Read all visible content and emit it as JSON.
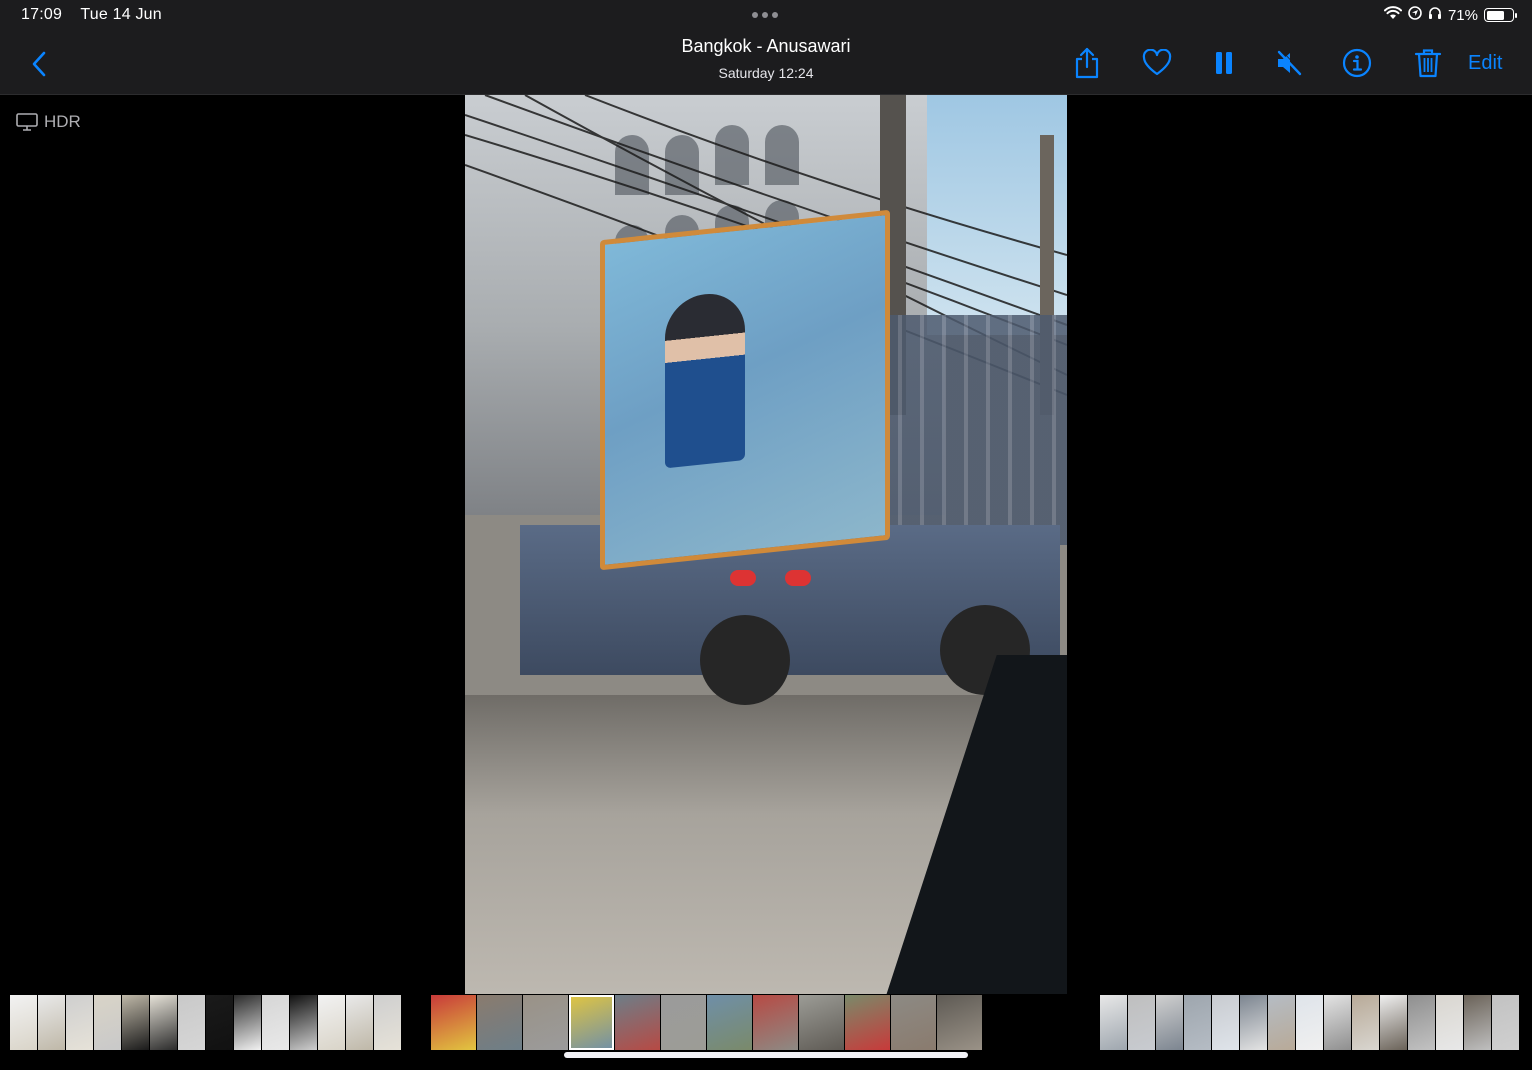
{
  "status_bar": {
    "time": "17:09",
    "date": "Tue 14 Jun",
    "battery_percent_label": "71%",
    "battery_level": 0.71,
    "icons": [
      "wifi-icon",
      "location-icon",
      "headphones-icon",
      "battery-icon"
    ]
  },
  "nav": {
    "title": "Bangkok - Anusawari",
    "subtitle": "Saturday  12:24",
    "edit_label": "Edit",
    "icons": [
      "back-chevron-icon",
      "share-icon",
      "heart-icon",
      "pause-icon",
      "mute-icon",
      "info-icon",
      "trash-icon"
    ],
    "accent_color": "#0a84ff"
  },
  "hdr": {
    "label": "HDR",
    "icon": "display-icon"
  },
  "media": {
    "type": "video",
    "state": "playing"
  },
  "thumbnails": {
    "groups": [
      {
        "kind": "documents",
        "count": 14,
        "colors": [
          "#f2f2f2",
          "#e9e9e9",
          "#cfcfcf",
          "#d9d4c8",
          "#bfb8a8",
          "#e6e2d8",
          "#c9c9c9",
          "#1a1a1a",
          "#2b2b2b",
          "#d6d6d6",
          "#111"
        ]
      },
      {
        "kind": "street-video",
        "count": 12,
        "colors": [
          "#c83a3a",
          "#8a7b6e",
          "#9a9287",
          "#e2c640",
          "#6d7e88",
          "#9b9b9b",
          "#6f8fa8",
          "#b74a44",
          "#9c9c96",
          "#7a8a6a",
          "#8d8a84",
          "#5e5a54"
        ]
      },
      {
        "kind": "laundry",
        "count": 15,
        "colors": [
          "#e8e8e8",
          "#bfbfbf",
          "#d0d0d0",
          "#9ea6ae",
          "#c8cbd0",
          "#7c8590",
          "#b5bcc4",
          "#dfe4ea",
          "#e4e4e4",
          "#b8aa98",
          "#f0f0f0",
          "#8f8f8f",
          "#d9d6d0",
          "#6a6258",
          "#c2c2c2"
        ]
      }
    ],
    "current_index": 17
  }
}
